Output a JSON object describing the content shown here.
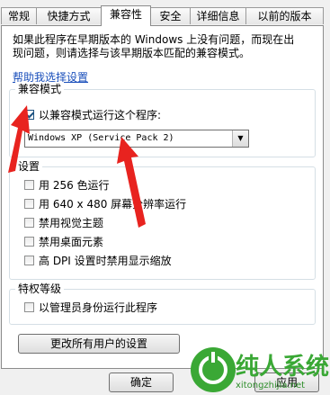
{
  "tabs": [
    {
      "label": "常规"
    },
    {
      "label": "快捷方式"
    },
    {
      "label": "兼容性",
      "active": true
    },
    {
      "label": "安全"
    },
    {
      "label": "详细信息"
    },
    {
      "label": "以前的版本"
    }
  ],
  "intro": {
    "line1": "如果此程序在早期版本的 Windows 上没有问题，而现在出",
    "line2": "现问题，则请选择与该早期版本匹配的兼容模式。"
  },
  "help_link": "帮助我选择设置",
  "compat_mode": {
    "title": "兼容模式",
    "checkbox_label": "以兼容模式运行这个程序:",
    "checked": true,
    "selected_os": "Windows XP (Service Pack 2)"
  },
  "settings": {
    "title": "设置",
    "options": [
      {
        "label": "用 256 色运行",
        "checked": false
      },
      {
        "label": "用 640 x 480 屏幕分辨率运行",
        "checked": false
      },
      {
        "label": "禁用视觉主题",
        "checked": false
      },
      {
        "label": "禁用桌面元素",
        "checked": false
      },
      {
        "label": "高 DPI 设置时禁用显示缩放",
        "checked": false
      }
    ]
  },
  "privilege": {
    "title": "特权等级",
    "admin_label": "以管理员身份运行此程序",
    "checked": false
  },
  "change_all_button": "更改所有用户的设置",
  "ok_button": "确定",
  "apply_button": "应用",
  "watermark": {
    "brand": "纯人系统",
    "url": "xitongzhijia.net"
  },
  "colors": {
    "arrow": "#e8231f",
    "link": "#1a4fbb",
    "watermark_green": "#3aa835"
  }
}
